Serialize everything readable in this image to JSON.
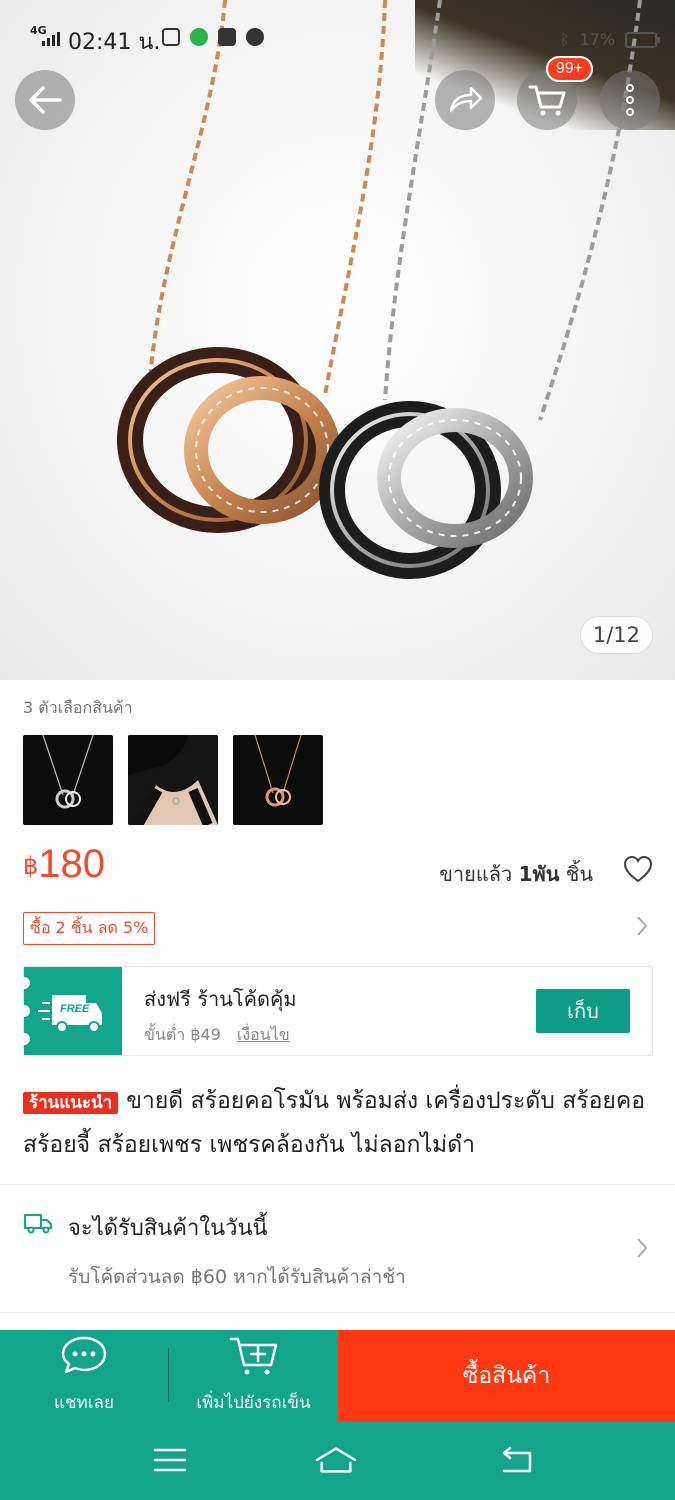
{
  "status_bar": {
    "network": "4G",
    "time": "02:41 น.",
    "battery": "17%"
  },
  "header": {
    "cart_badge": "99+"
  },
  "gallery": {
    "page_indicator": "1/12"
  },
  "variations": {
    "label": "3 ตัวเลือกสินค้า"
  },
  "price": {
    "currency": "฿",
    "amount": "180"
  },
  "sold": {
    "prefix": "ขายแล้ว",
    "count": "1พัน",
    "suffix": "ชิ้น"
  },
  "promo": {
    "bundle_tag": "ซื้อ 2 ชิ้น ลด 5%"
  },
  "voucher": {
    "badge": "FREE",
    "title": "ส่งฟรี ร้านโค้ดคุ้ม",
    "min_spend": "ขั้นต่ำ ฿49",
    "conditions_link": "เงื่อนไข",
    "claim_label": "เก็บ"
  },
  "product": {
    "tag": "ร้านแนะนำ",
    "title": "ขายดี สร้อยคอโรมัน พร้อมส่ง เครื่องประดับ สร้อยคอ สร้อยจี้ สร้อยเพชร เพชรคล้องกัน ไม่ลอกไม่ดำ"
  },
  "delivery": {
    "title": "จะได้รับสินค้าในวันนี้",
    "subtitle": "รับโค้ดส่วนลด ฿60 หากได้รับสินค้าล่าช้า"
  },
  "bottom_bar": {
    "chat_label": "แชทเลย",
    "add_to_cart_label": "เพิ่มไปยังรถเข็น",
    "buy_label": "ซื้อสินค้า"
  },
  "colors": {
    "accent": "#ee4d2d",
    "teal": "#13a589",
    "buy": "#fe3912"
  }
}
